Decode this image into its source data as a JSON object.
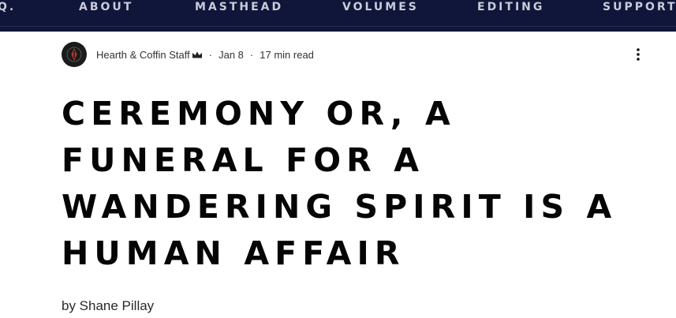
{
  "nav": {
    "items": [
      "Q.",
      "ABOUT",
      "MASTHEAD",
      "VOLUMES",
      "EDITING",
      "SUPPORT"
    ],
    "background_color": "#10163a"
  },
  "post": {
    "author": "Hearth & Coffin Staff",
    "author_badge_icon": "crown-icon",
    "date": "Jan 8",
    "read_time": "17 min read",
    "separator": "·",
    "more_icon": "more-vertical-icon",
    "title": "CEREMONY OR, A FUNERAL FOR A WANDERING SPIRIT IS A HUMAN AFFAIR",
    "byline": "by Shane Pillay"
  }
}
